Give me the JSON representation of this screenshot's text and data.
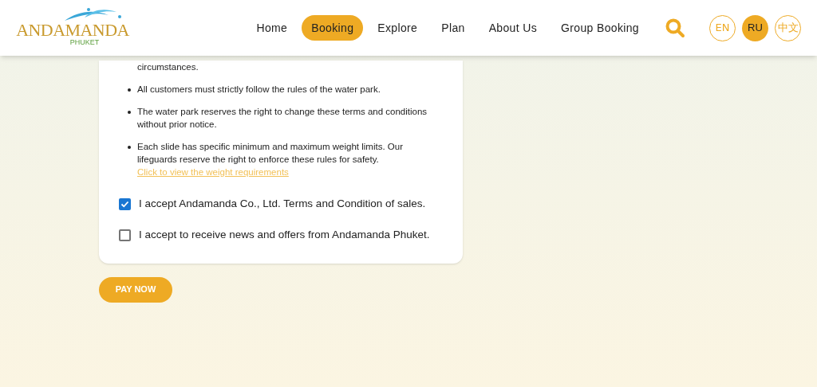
{
  "logo": {
    "name": "ANDAMANDA",
    "sub": "PHUKET"
  },
  "nav": [
    {
      "label": "Home",
      "selected": false
    },
    {
      "label": "Booking",
      "selected": true
    },
    {
      "label": "Explore",
      "selected": false
    },
    {
      "label": "Plan",
      "selected": false
    },
    {
      "label": "About Us",
      "selected": false
    },
    {
      "label": "Group Booking",
      "selected": false
    }
  ],
  "languages": [
    {
      "label": "EN",
      "selected": false
    },
    {
      "label": "RU",
      "selected": true
    },
    {
      "label": "中文",
      "selected": false
    }
  ],
  "terms": [
    {
      "text": "circumstances.",
      "continued": true
    },
    {
      "text": "All customers must strictly follow the rules of the water park."
    },
    {
      "text": "The water park reserves the right to change these terms and conditions without prior notice."
    },
    {
      "text": "Each slide has specific minimum and maximum weight limits. Our lifeguards reserve the right to enforce these rules for safety.",
      "link": "Click to view the weight requirements"
    }
  ],
  "consents": [
    {
      "label": "I accept Andamanda Co., Ltd. Terms and Condition of sales.",
      "checked": true
    },
    {
      "label": "I accept to receive news and offers from Andamanda Phuket.",
      "checked": false
    }
  ],
  "pay_button": "PAY NOW"
}
